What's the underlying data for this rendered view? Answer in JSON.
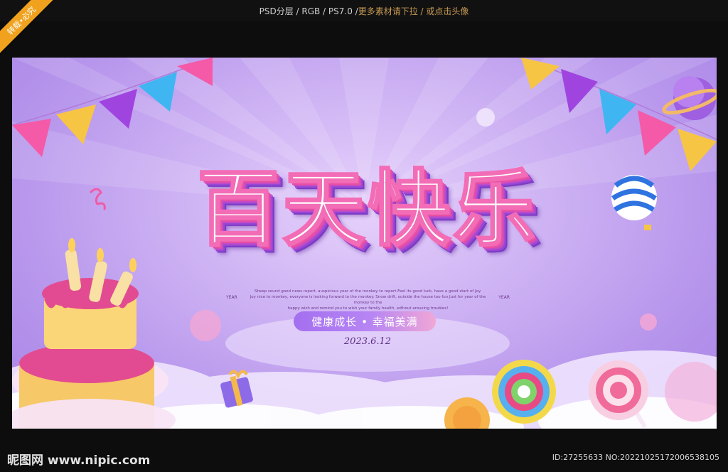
{
  "topbar": {
    "text_main": "PSD分层 / RGB / PS7.0 / ",
    "text_highlight": "更多素材请下拉 / 或点击头像"
  },
  "ribbon": {
    "label": "转载•必究"
  },
  "poster": {
    "title": "百天快乐",
    "english_lines": [
      "Sheep sound good news report, auspicious year of the monkey to report.Feel its good luck, have a good start of joy.",
      "Joy nice to monkey, everyone is looking forward to the monkey. Snow drift, outside the house too fun.Just for year of the monkey to the",
      "happy wish and remind you to wish your family health, without arousing troubles!"
    ],
    "english_side_left": "YEAR",
    "english_side_right": "YEAR",
    "slogan": "健康成长 • 幸福美满",
    "date": "2023.6.12"
  },
  "footer": {
    "logo_text": "昵图网 www.nipic.com",
    "id_text": "ID:27255633 NO:20221025172006538105"
  },
  "colors": {
    "accent_pink": "#f36cb6",
    "accent_purple": "#9747d3",
    "ribbon_orange": "#f0a21f"
  }
}
